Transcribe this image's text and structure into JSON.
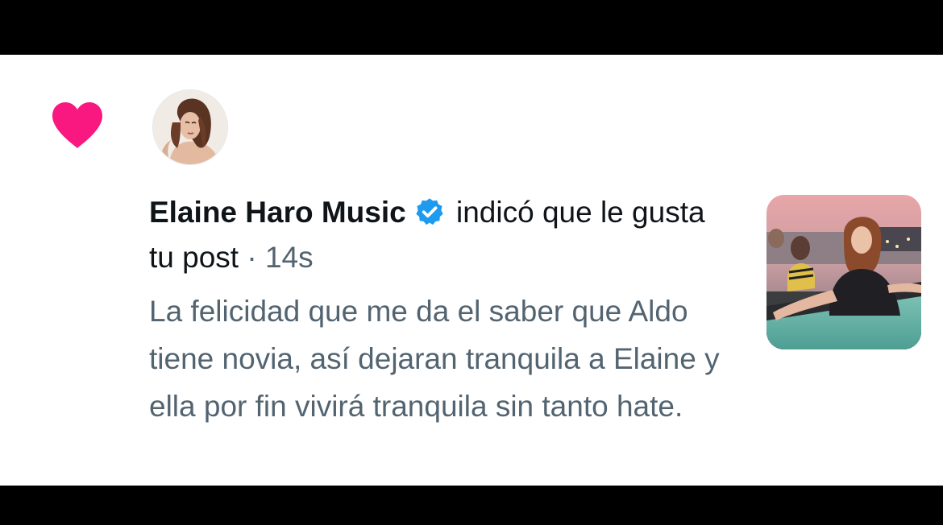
{
  "notification": {
    "author_name": "Elaine Haro Music",
    "action_text": " indicó que le gusta tu post",
    "separator": " · ",
    "timestamp": "14s",
    "post_text": "La felicidad que me da el saber que Aldo tiene novia, así dejaran tranquila a Elaine y ella por fin vivirá tranquila sin tanto hate.",
    "icons": {
      "like": "heart-icon",
      "verified": "verified-badge-icon"
    }
  },
  "colors": {
    "heart": "#f91880",
    "verified": "#1d9bf0",
    "primary_text": "#0f1419",
    "secondary_text": "#536471",
    "background": "#ffffff",
    "letterbox": "#000000"
  }
}
